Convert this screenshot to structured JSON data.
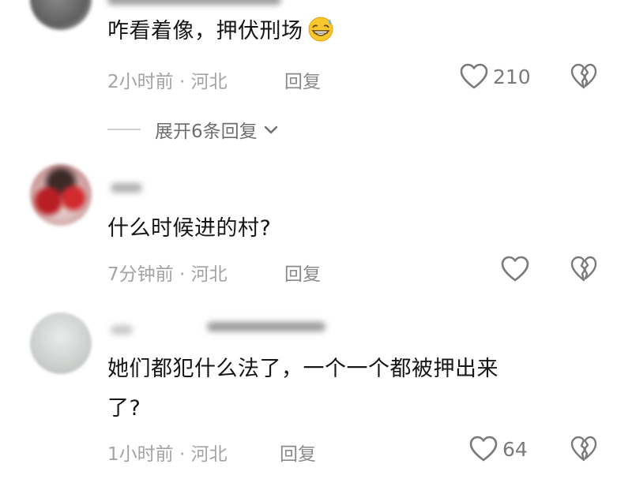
{
  "comments": [
    {
      "text": "咋看着像，押伏刑场",
      "emoji": "grinning-sweat-emoji",
      "time": "2小时前",
      "sep": " · ",
      "location": "河北",
      "reply": "回复",
      "likes": "210"
    },
    {
      "text": "什么时候进的村?",
      "time": "7分钟前",
      "sep": " · ",
      "location": "河北",
      "reply": "回复",
      "likes": ""
    },
    {
      "text_line1": "她们都犯什么法了，一个一个都被押出来",
      "text_line2": "了?",
      "time": "1小时前",
      "sep": " · ",
      "location": "河北",
      "reply": "回复",
      "likes": "64"
    }
  ],
  "expand_replies": "展开6条回复",
  "colors": {
    "text": "#161616",
    "meta": "#a3a3a3",
    "icon": "#7a7a7a"
  },
  "icons": [
    "heart-outline-icon",
    "broken-heart-icon",
    "chevron-down-icon"
  ]
}
